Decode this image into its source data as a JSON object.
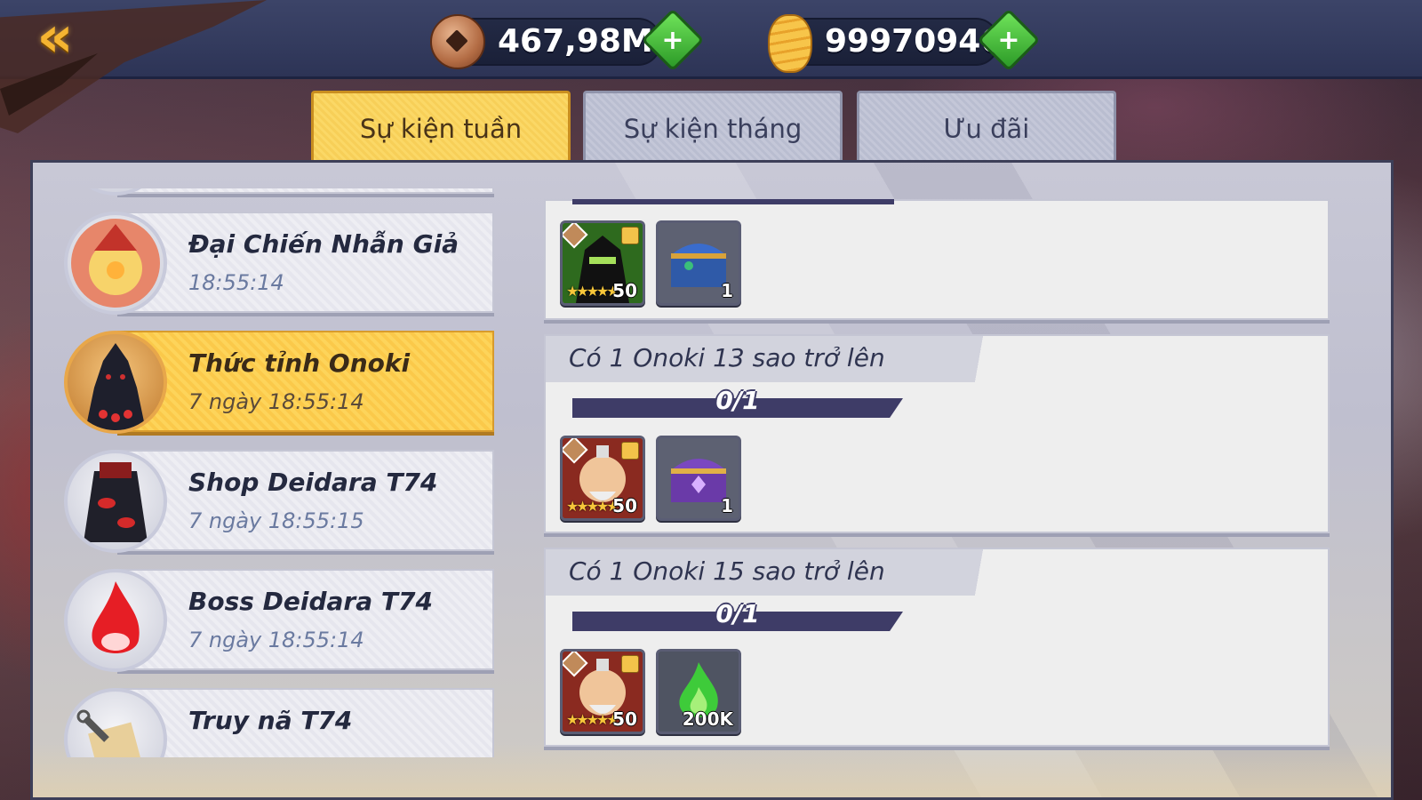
{
  "currency": {
    "coins": "467,98M",
    "ryo": "99970946"
  },
  "tabs": [
    {
      "label": "Sự kiện tuần",
      "active": true
    },
    {
      "label": "Sự kiện tháng",
      "active": false
    },
    {
      "label": "Ưu đãi",
      "active": false
    }
  ],
  "events": [
    {
      "title": "Đại Chiến Nhẫn Giả",
      "time": "18:55:14"
    },
    {
      "title": "Thức tỉnh Onoki",
      "time": "7 ngày 18:55:14",
      "active": true
    },
    {
      "title": "Shop Deidara T74",
      "time": "7 ngày 18:55:15"
    },
    {
      "title": "Boss Deidara T74",
      "time": "7 ngày 18:55:14"
    },
    {
      "title": "Truy nã T74",
      "time": ""
    }
  ],
  "missions": [
    {
      "title": "",
      "rewards": [
        {
          "icon": "zetsu-fragment-icon",
          "count": "50"
        },
        {
          "icon": "blue-chest-icon",
          "count": "1"
        }
      ]
    },
    {
      "title": "Có 1 Onoki 13 sao trở lên",
      "progress": "0/1",
      "progress_fraction": 0,
      "rewards": [
        {
          "icon": "onoki-fragment-icon",
          "count": "50"
        },
        {
          "icon": "purple-chest-icon",
          "count": "1"
        }
      ]
    },
    {
      "title": "Có 1 Onoki 15 sao trở lên",
      "progress": "0/1",
      "progress_fraction": 0,
      "rewards": [
        {
          "icon": "onoki-fragment-icon",
          "count": "50"
        },
        {
          "icon": "green-flame-icon",
          "count": "200K"
        }
      ]
    }
  ],
  "colors": {
    "accent_yellow": "#f7cf58",
    "progress_track": "#3e3c67",
    "plus_green": "#2c9a27"
  }
}
